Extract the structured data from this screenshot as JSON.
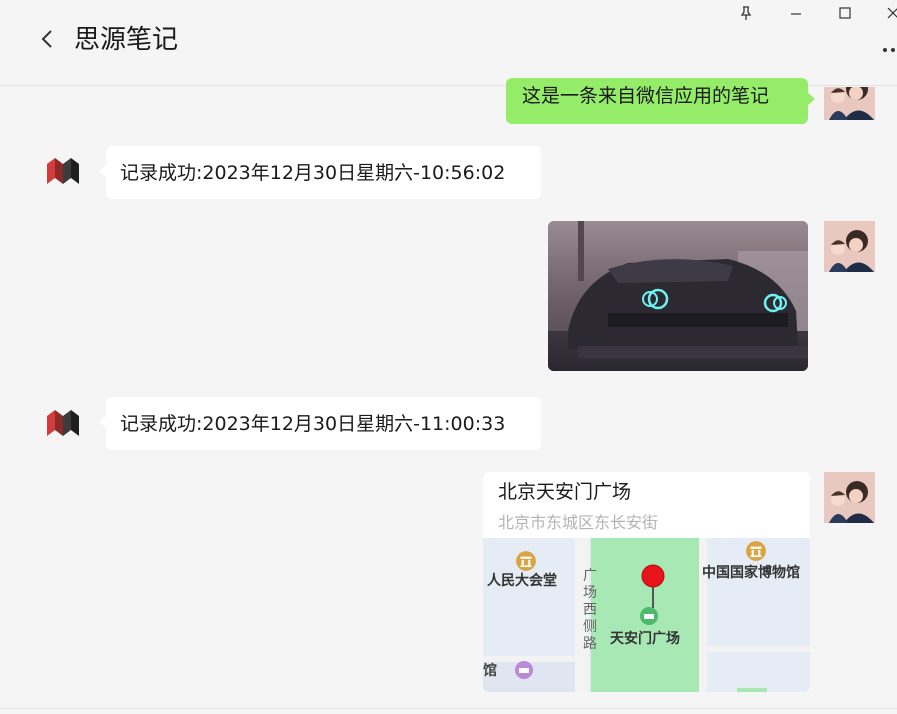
{
  "window": {
    "title": "思源笔记",
    "controls": [
      "pin-icon",
      "minimize-icon",
      "maximize-icon",
      "close-icon"
    ]
  },
  "messages": [
    {
      "type": "text",
      "side": "right",
      "text": "这是一条来自微信应用的笔记"
    },
    {
      "type": "text",
      "side": "left",
      "text": "记录成功:2023年12月30日星期六-10:56:02"
    },
    {
      "type": "image",
      "side": "right",
      "description": "car-photo"
    },
    {
      "type": "text",
      "side": "left",
      "text": "记录成功:2023年12月30日星期六-11:00:33"
    },
    {
      "type": "location",
      "side": "right",
      "name": "北京天安门广场",
      "address": "北京市东城区东长安街",
      "map_labels": {
        "great_hall": "人民大会堂",
        "museum": "中国国家博物馆",
        "square": "天安门广场",
        "west_road": "广场西侧路",
        "hotel": "宾馆"
      }
    }
  ],
  "colors": {
    "sent_bubble": "#95ec69",
    "received_bubble": "#ffffff",
    "background": "#f5f5f5",
    "map_pin": "#e8141b",
    "map_green": "#a8e8b4"
  }
}
